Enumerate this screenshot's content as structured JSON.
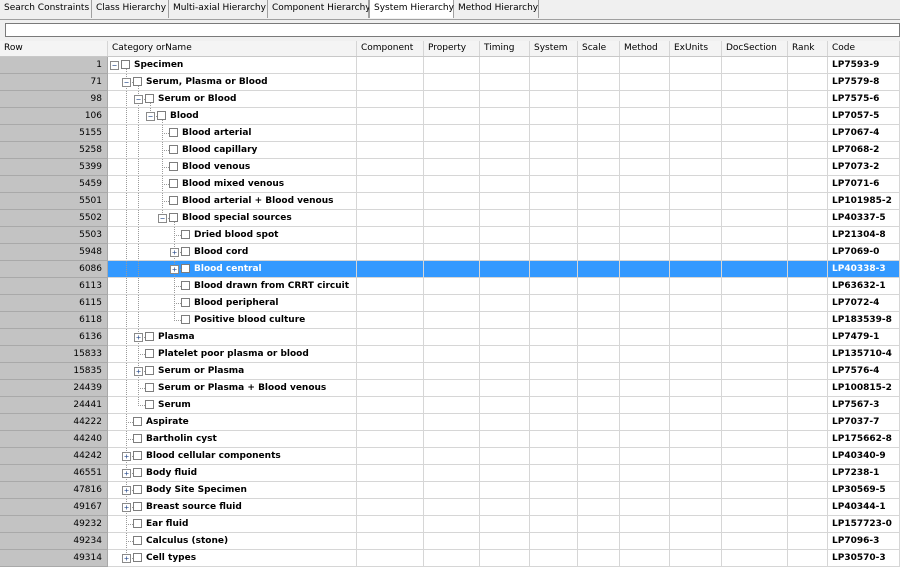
{
  "tabs": [
    "Search Constraints",
    "Class Hierarchy",
    "Multi-axial Hierarchy",
    "Component Hierarchy",
    "System Hierarchy",
    "Method Hierarchy"
  ],
  "active_tab": "System Hierarchy",
  "filter_value": "",
  "columns": [
    "Row",
    "Category orName",
    "Component",
    "Property",
    "Timing",
    "System",
    "Scale",
    "Method",
    "ExUnits",
    "DocSection",
    "Rank",
    "Code"
  ],
  "colors": {
    "selected": "#3399ff",
    "row_header_bg": "#c3c3c3",
    "expander": "#2b4d8b"
  },
  "rows": [
    {
      "row": "1",
      "name": "Specimen",
      "code": "LP7593-9",
      "level": 0,
      "expander": "minus"
    },
    {
      "row": "71",
      "name": "Serum, Plasma or Blood",
      "code": "LP7579-8",
      "level": 1,
      "expander": "minus"
    },
    {
      "row": "98",
      "name": "Serum or Blood",
      "code": "LP7575-6",
      "level": 2,
      "expander": "minus"
    },
    {
      "row": "106",
      "name": "Blood",
      "code": "LP7057-5",
      "level": 3,
      "expander": "minus"
    },
    {
      "row": "5155",
      "name": "Blood arterial",
      "code": "LP7067-4",
      "level": 4,
      "expander": "none"
    },
    {
      "row": "5258",
      "name": "Blood capillary",
      "code": "LP7068-2",
      "level": 4,
      "expander": "none"
    },
    {
      "row": "5399",
      "name": "Blood venous",
      "code": "LP7073-2",
      "level": 4,
      "expander": "none"
    },
    {
      "row": "5459",
      "name": "Blood mixed venous",
      "code": "LP7071-6",
      "level": 4,
      "expander": "none"
    },
    {
      "row": "5501",
      "name": "Blood arterial + Blood venous",
      "code": "LP101985-2",
      "level": 4,
      "expander": "none"
    },
    {
      "row": "5502",
      "name": "Blood special sources",
      "code": "LP40337-5",
      "level": 4,
      "expander": "minus"
    },
    {
      "row": "5503",
      "name": "Dried blood spot",
      "code": "LP21304-8",
      "level": 5,
      "expander": "none"
    },
    {
      "row": "5948",
      "name": "Blood cord",
      "code": "LP7069-0",
      "level": 5,
      "expander": "plus"
    },
    {
      "row": "6086",
      "name": "Blood central",
      "code": "LP40338-3",
      "level": 5,
      "expander": "plus",
      "selected": true
    },
    {
      "row": "6113",
      "name": "Blood drawn from CRRT circuit",
      "code": "LP63632-1",
      "level": 5,
      "expander": "none"
    },
    {
      "row": "6115",
      "name": "Blood peripheral",
      "code": "LP7072-4",
      "level": 5,
      "expander": "none"
    },
    {
      "row": "6118",
      "name": "Positive blood culture",
      "code": "LP183539-8",
      "level": 5,
      "expander": "none"
    },
    {
      "row": "6136",
      "name": "Plasma",
      "code": "LP7479-1",
      "level": 2,
      "expander": "plus"
    },
    {
      "row": "15833",
      "name": "Platelet poor plasma or blood",
      "code": "LP135710-4",
      "level": 2,
      "expander": "none"
    },
    {
      "row": "15835",
      "name": "Serum or Plasma",
      "code": "LP7576-4",
      "level": 2,
      "expander": "plus"
    },
    {
      "row": "24439",
      "name": "Serum or Plasma + Blood venous",
      "code": "LP100815-2",
      "level": 2,
      "expander": "none"
    },
    {
      "row": "24441",
      "name": "Serum",
      "code": "LP7567-3",
      "level": 2,
      "expander": "none"
    },
    {
      "row": "44222",
      "name": "Aspirate",
      "code": "LP7037-7",
      "level": 1,
      "expander": "none"
    },
    {
      "row": "44240",
      "name": "Bartholin cyst",
      "code": "LP175662-8",
      "level": 1,
      "expander": "none"
    },
    {
      "row": "44242",
      "name": "Blood cellular components",
      "code": "LP40340-9",
      "level": 1,
      "expander": "plus"
    },
    {
      "row": "46551",
      "name": "Body fluid",
      "code": "LP7238-1",
      "level": 1,
      "expander": "plus"
    },
    {
      "row": "47816",
      "name": "Body Site Specimen",
      "code": "LP30569-5",
      "level": 1,
      "expander": "plus"
    },
    {
      "row": "49167",
      "name": "Breast source fluid",
      "code": "LP40344-1",
      "level": 1,
      "expander": "plus"
    },
    {
      "row": "49232",
      "name": "Ear fluid",
      "code": "LP157723-0",
      "level": 1,
      "expander": "none"
    },
    {
      "row": "49234",
      "name": "Calculus (stone)",
      "code": "LP7096-3",
      "level": 1,
      "expander": "none"
    },
    {
      "row": "49314",
      "name": "Cell types",
      "code": "LP30570-3",
      "level": 1,
      "expander": "plus"
    }
  ]
}
